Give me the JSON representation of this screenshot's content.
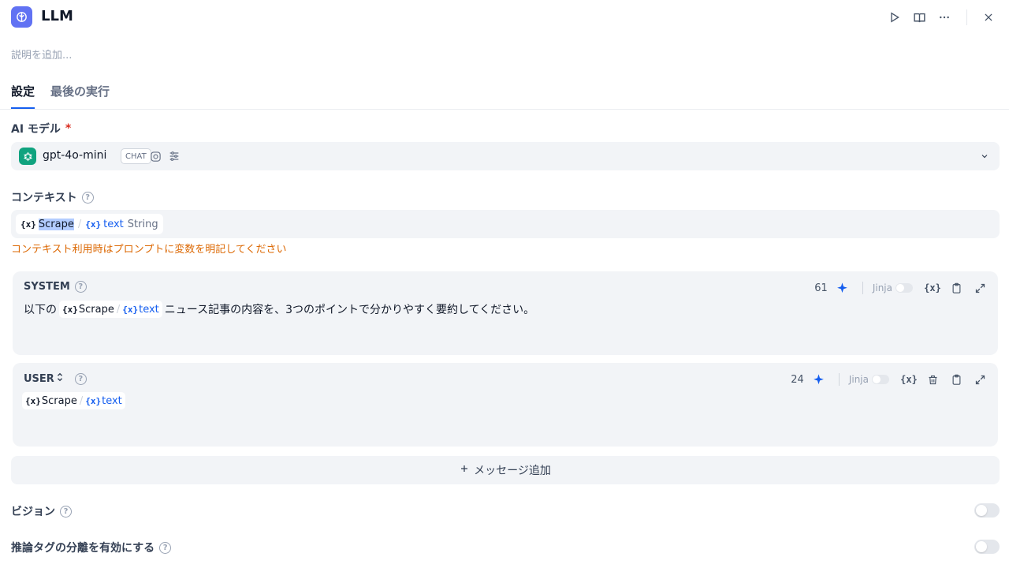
{
  "header": {
    "title": "LLM",
    "description_placeholder": "説明を追加..."
  },
  "tabs": [
    {
      "label": "設定",
      "active": true
    },
    {
      "label": "最後の実行",
      "active": false
    }
  ],
  "model": {
    "section_label": "AI モデル",
    "required_mark": "*",
    "name": "gpt-4o-mini",
    "badge": "CHAT"
  },
  "context": {
    "section_label": "コンテキスト",
    "node": "Scrape",
    "separator": "/",
    "variable": "text",
    "type": "String",
    "warning": "コンテキスト利用時はプロンプトに変数を明記してください"
  },
  "system_prompt": {
    "role": "SYSTEM",
    "count": "61",
    "jinja_label": "Jinja",
    "text_before": "以下の",
    "chip_node": "Scrape",
    "chip_var": "text",
    "text_after": "ニュース記事の内容を、3つのポイントで分かりやすく要約してください。"
  },
  "user_prompt": {
    "role": "USER",
    "count": "24",
    "jinja_label": "Jinja",
    "chip_node": "Scrape",
    "chip_var": "text"
  },
  "var_glyph": "{x}",
  "add_message": {
    "label": "メッセージ追加"
  },
  "vision": {
    "label": "ビジョン",
    "enabled": false
  },
  "reasoning_tag": {
    "label": "推論タグの分離を有効にする",
    "enabled": false
  },
  "colors": {
    "accent": "#155eef",
    "warning": "#dc6803",
    "required": "#d92d20",
    "app_icon": "#6172f3",
    "openai": "#10a37f"
  }
}
